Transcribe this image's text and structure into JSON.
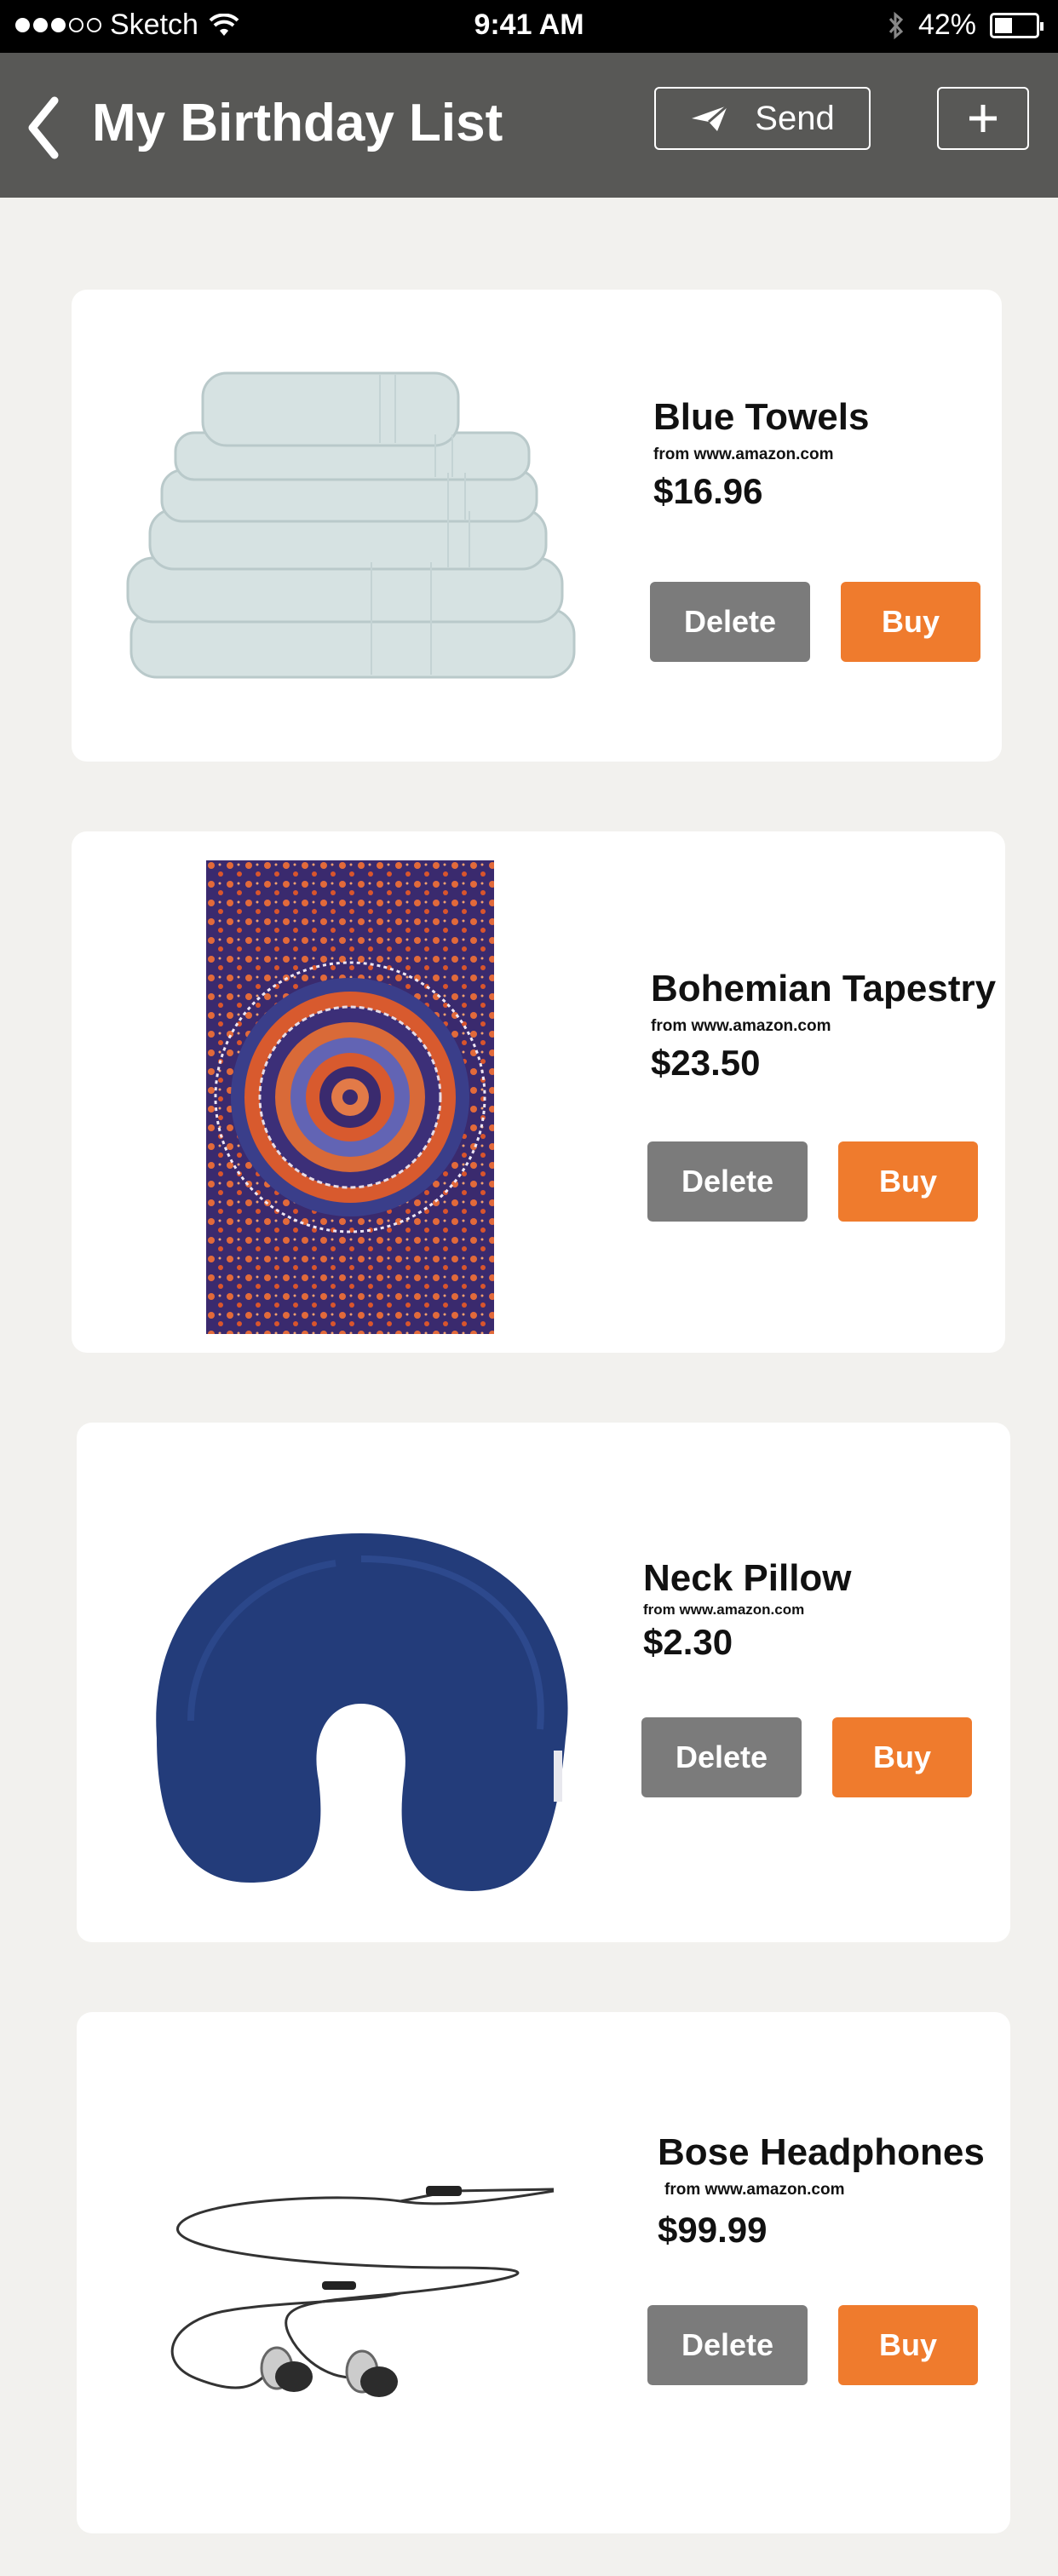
{
  "status_bar": {
    "carrier": "Sketch",
    "time": "9:41 AM",
    "battery": "42%",
    "battery_level": 0.42
  },
  "header": {
    "title": "My Birthday List",
    "send_label": "Send"
  },
  "items": [
    {
      "name": "Blue Towels",
      "source": "from www.amazon.com",
      "price": "$16.96",
      "delete_label": "Delete",
      "buy_label": "Buy"
    },
    {
      "name": "Bohemian Tapestry",
      "source": "from www.amazon.com",
      "price": "$23.50",
      "delete_label": "Delete",
      "buy_label": "Buy"
    },
    {
      "name": "Neck Pillow",
      "source": "from www.amazon.com",
      "price": "$2.30",
      "delete_label": "Delete",
      "buy_label": "Buy"
    },
    {
      "name": "Bose Headphones",
      "source": "from www.amazon.com",
      "price": "$99.99",
      "delete_label": "Delete",
      "buy_label": "Buy"
    }
  ],
  "colors": {
    "header_bg": "#585856",
    "delete_bg": "#7b7b7b",
    "buy_bg": "#ef7b2d",
    "page_bg": "#f2f1ee"
  }
}
